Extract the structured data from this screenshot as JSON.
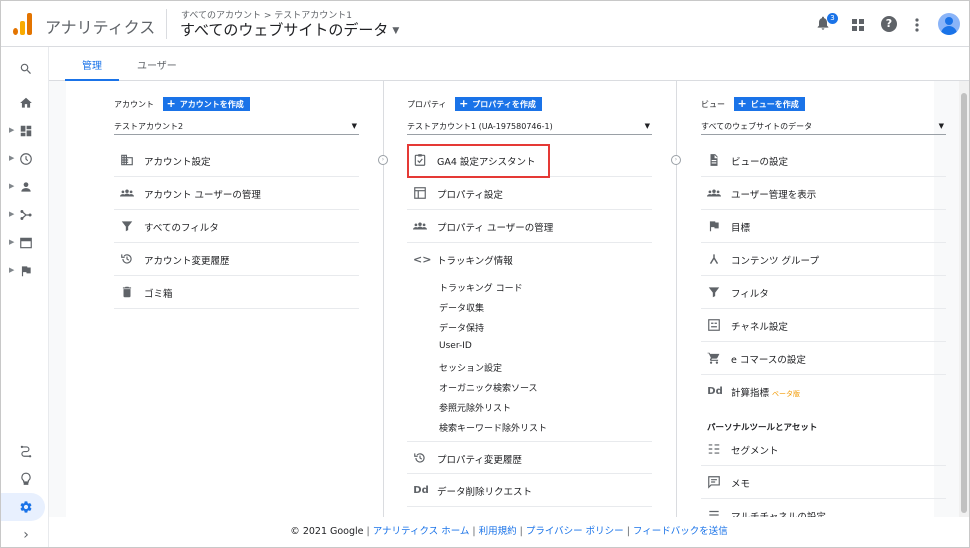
{
  "app": {
    "title": "アナリティクス",
    "breadcrumb": "すべてのアカウント > テストアカウント1",
    "view_title": "すべてのウェブサイトのデータ"
  },
  "header": {
    "notification_count": "3"
  },
  "tabs": [
    {
      "label": "管理",
      "active": true
    },
    {
      "label": "ユーザー",
      "active": false
    }
  ],
  "account": {
    "label": "アカウント",
    "create_label": "アカウントを作成",
    "selected": "テストアカウント2",
    "items": [
      {
        "label": "アカウント設定",
        "icon": "building-icon"
      },
      {
        "label": "アカウント ユーザーの管理",
        "icon": "people-icon"
      },
      {
        "label": "すべてのフィルタ",
        "icon": "filter-icon"
      },
      {
        "label": "アカウント変更履歴",
        "icon": "history-icon"
      },
      {
        "label": "ゴミ箱",
        "icon": "trash-icon"
      }
    ]
  },
  "property": {
    "label": "プロパティ",
    "create_label": "プロパティを作成",
    "selected": "テストアカウント1 (UA-197580746-1)",
    "items": [
      {
        "label": "GA4 設定アシスタント",
        "icon": "checklist-icon",
        "highlighted": true
      },
      {
        "label": "プロパティ設定",
        "icon": "property-settings-icon"
      },
      {
        "label": "プロパティ ユーザーの管理",
        "icon": "people-icon"
      },
      {
        "label": "トラッキング情報",
        "icon": "code-icon"
      }
    ],
    "tracking_sub": [
      "トラッキング コード",
      "データ収集",
      "データ保持",
      "User-ID",
      "セッション設定",
      "オーガニック検索ソース",
      "参照元除外リスト",
      "検索キーワード除外リスト"
    ],
    "items_after": [
      {
        "label": "プロパティ変更履歴",
        "icon": "history-icon"
      },
      {
        "label": "データ削除リクエスト",
        "icon": "dd-icon"
      }
    ]
  },
  "view": {
    "label": "ビュー",
    "create_label": "ビューを作成",
    "selected": "すべてのウェブサイトのデータ",
    "items": [
      {
        "label": "ビューの設定",
        "icon": "document-icon"
      },
      {
        "label": "ユーザー管理を表示",
        "icon": "people-icon"
      },
      {
        "label": "目標",
        "icon": "flag-icon"
      },
      {
        "label": "コンテンツ グループ",
        "icon": "content-group-icon"
      },
      {
        "label": "フィルタ",
        "icon": "filter-icon"
      },
      {
        "label": "チャネル設定",
        "icon": "channel-icon"
      },
      {
        "label": "e コマースの設定",
        "icon": "cart-icon"
      },
      {
        "label": "計算指標",
        "icon": "dd-icon",
        "badge": "ベータ版"
      }
    ],
    "section_label": "パーソナルツールとアセット",
    "personal_items": [
      {
        "label": "セグメント",
        "icon": "segment-icon"
      },
      {
        "label": "メモ",
        "icon": "note-icon"
      },
      {
        "label": "マルチチャネルの設定",
        "icon": "multichannel-icon"
      }
    ]
  },
  "footer": {
    "copyright": "© 2021 Google",
    "links": [
      "アナリティクス ホーム",
      "利用規約",
      "プライバシー ポリシー",
      "フィードバックを送信"
    ]
  },
  "colors": {
    "accent": "#1a73e8",
    "highlight": "#e53935",
    "logo_orange": "#f9ab00",
    "logo_dark": "#e37400"
  }
}
